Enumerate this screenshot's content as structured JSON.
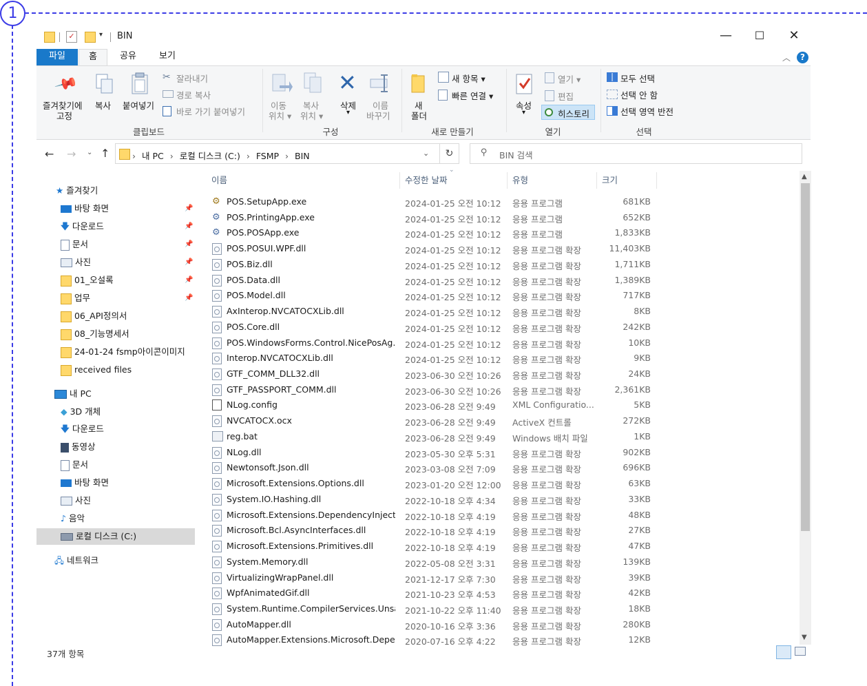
{
  "annotation": {
    "number": "1"
  },
  "window": {
    "title": "BIN",
    "controls": {
      "minimize": "—",
      "maximize": "☐",
      "close": "✕"
    }
  },
  "ribbon_tabs": [
    "파일",
    "홈",
    "공유",
    "보기"
  ],
  "ribbon": {
    "pin_quick": "즐겨찾기에",
    "pin_quick2": "고정",
    "copy": "복사",
    "paste": "붙여넣기",
    "cut": "잘라내기",
    "copy_path": "경로 복사",
    "paste_shortcut": "바로 가기 붙여넣기",
    "group_clipboard": "클립보드",
    "move_to": "이동",
    "move_to2": "위치",
    "copy_to": "복사",
    "copy_to2": "위치",
    "delete": "삭제",
    "rename": "이름",
    "rename2": "바꾸기",
    "group_organize": "구성",
    "new_folder": "새",
    "new_folder2": "폴더",
    "new_item": "새 항목",
    "easy_access": "빠른 연결",
    "group_new": "새로 만들기",
    "properties": "속성",
    "open": "열기",
    "edit": "편집",
    "history": "히스토리",
    "group_open": "열기",
    "select_all": "모두 선택",
    "select_none": "선택 안 함",
    "invert_selection": "선택 영역 반전",
    "group_select": "선택"
  },
  "address": {
    "crumbs": [
      "내 PC",
      "로컬 디스크 (C:)",
      "FSMP",
      "BIN"
    ],
    "search_placeholder": "BIN 검색"
  },
  "nav": {
    "quick_access": "즐겨찾기",
    "quick_items": [
      "바탕 화면",
      "다운로드",
      "문서",
      "사진",
      "01_오설록",
      "업무",
      "06_API정의서",
      "08_기능명세서",
      "24-01-24 fsmp아이콘이미지",
      "received files"
    ],
    "this_pc": "내 PC",
    "pc_items": [
      "3D 개체",
      "다운로드",
      "동영상",
      "문서",
      "바탕 화면",
      "사진",
      "음악",
      "로컬 디스크 (C:)"
    ],
    "network": "네트워크"
  },
  "columns": {
    "name": "이름",
    "date": "수정한 날짜",
    "type": "유형",
    "size": "크기"
  },
  "files": [
    {
      "name": "POS.SetupApp.exe",
      "date": "2024-01-25 오전 10:12",
      "type": "응용 프로그램",
      "size": "681KB",
      "icon": "setup-exe"
    },
    {
      "name": "POS.PrintingApp.exe",
      "date": "2024-01-25 오전 10:12",
      "type": "응용 프로그램",
      "size": "652KB",
      "icon": "exe"
    },
    {
      "name": "POS.POSApp.exe",
      "date": "2024-01-25 오전 10:12",
      "type": "응용 프로그램",
      "size": "1,833KB",
      "icon": "exe"
    },
    {
      "name": "POS.POSUI.WPF.dll",
      "date": "2024-01-25 오전 10:12",
      "type": "응용 프로그램 확장",
      "size": "11,403KB",
      "icon": "dll"
    },
    {
      "name": "POS.Biz.dll",
      "date": "2024-01-25 오전 10:12",
      "type": "응용 프로그램 확장",
      "size": "1,711KB",
      "icon": "dll"
    },
    {
      "name": "POS.Data.dll",
      "date": "2024-01-25 오전 10:12",
      "type": "응용 프로그램 확장",
      "size": "1,389KB",
      "icon": "dll"
    },
    {
      "name": "POS.Model.dll",
      "date": "2024-01-25 오전 10:12",
      "type": "응용 프로그램 확장",
      "size": "717KB",
      "icon": "dll"
    },
    {
      "name": "AxInterop.NVCATOCXLib.dll",
      "date": "2024-01-25 오전 10:12",
      "type": "응용 프로그램 확장",
      "size": "8KB",
      "icon": "dll"
    },
    {
      "name": "POS.Core.dll",
      "date": "2024-01-25 오전 10:12",
      "type": "응용 프로그램 확장",
      "size": "242KB",
      "icon": "dll"
    },
    {
      "name": "POS.WindowsForms.Control.NicePosAg...",
      "date": "2024-01-25 오전 10:12",
      "type": "응용 프로그램 확장",
      "size": "10KB",
      "icon": "dll"
    },
    {
      "name": "Interop.NVCATOCXLib.dll",
      "date": "2024-01-25 오전 10:12",
      "type": "응용 프로그램 확장",
      "size": "9KB",
      "icon": "dll"
    },
    {
      "name": "GTF_COMM_DLL32.dll",
      "date": "2023-06-30 오전 10:26",
      "type": "응용 프로그램 확장",
      "size": "24KB",
      "icon": "dll"
    },
    {
      "name": "GTF_PASSPORT_COMM.dll",
      "date": "2023-06-30 오전 10:26",
      "type": "응용 프로그램 확장",
      "size": "2,361KB",
      "icon": "dll"
    },
    {
      "name": "NLog.config",
      "date": "2023-06-28 오전 9:49",
      "type": "XML Configuratio...",
      "size": "5KB",
      "icon": "config"
    },
    {
      "name": "NVCATOCX.ocx",
      "date": "2023-06-28 오전 9:49",
      "type": "ActiveX 컨트롤",
      "size": "272KB",
      "icon": "dll"
    },
    {
      "name": "reg.bat",
      "date": "2023-06-28 오전 9:49",
      "type": "Windows 배치 파일",
      "size": "1KB",
      "icon": "bat"
    },
    {
      "name": "NLog.dll",
      "date": "2023-05-30 오후 5:31",
      "type": "응용 프로그램 확장",
      "size": "902KB",
      "icon": "dll"
    },
    {
      "name": "Newtonsoft.Json.dll",
      "date": "2023-03-08 오전 7:09",
      "type": "응용 프로그램 확장",
      "size": "696KB",
      "icon": "dll"
    },
    {
      "name": "Microsoft.Extensions.Options.dll",
      "date": "2023-01-20 오전 12:00",
      "type": "응용 프로그램 확장",
      "size": "63KB",
      "icon": "dll"
    },
    {
      "name": "System.IO.Hashing.dll",
      "date": "2022-10-18 오후 4:34",
      "type": "응용 프로그램 확장",
      "size": "33KB",
      "icon": "dll"
    },
    {
      "name": "Microsoft.Extensions.DependencyInjecti...",
      "date": "2022-10-18 오후 4:19",
      "type": "응용 프로그램 확장",
      "size": "48KB",
      "icon": "dll"
    },
    {
      "name": "Microsoft.Bcl.AsyncInterfaces.dll",
      "date": "2022-10-18 오후 4:19",
      "type": "응용 프로그램 확장",
      "size": "27KB",
      "icon": "dll"
    },
    {
      "name": "Microsoft.Extensions.Primitives.dll",
      "date": "2022-10-18 오후 4:19",
      "type": "응용 프로그램 확장",
      "size": "47KB",
      "icon": "dll"
    },
    {
      "name": "System.Memory.dll",
      "date": "2022-05-08 오전 3:31",
      "type": "응용 프로그램 확장",
      "size": "139KB",
      "icon": "dll"
    },
    {
      "name": "VirtualizingWrapPanel.dll",
      "date": "2021-12-17 오후 7:30",
      "type": "응용 프로그램 확장",
      "size": "39KB",
      "icon": "dll"
    },
    {
      "name": "WpfAnimatedGif.dll",
      "date": "2021-10-23 오후 4:53",
      "type": "응용 프로그램 확장",
      "size": "42KB",
      "icon": "dll"
    },
    {
      "name": "System.Runtime.CompilerServices.Unsaf...",
      "date": "2021-10-22 오후 11:40",
      "type": "응용 프로그램 확장",
      "size": "18KB",
      "icon": "dll"
    },
    {
      "name": "AutoMapper.dll",
      "date": "2020-10-16 오후 3:36",
      "type": "응용 프로그램 확장",
      "size": "280KB",
      "icon": "dll"
    },
    {
      "name": "AutoMapper.Extensions.Microsoft.Depe...",
      "date": "2020-07-16 오후 4:22",
      "type": "응용 프로그램 확장",
      "size": "12KB",
      "icon": "dll"
    }
  ],
  "status": {
    "item_count": "37개 항목"
  },
  "colors": {
    "accent": "#1979ca",
    "annotation": "#3b3be6",
    "folder": "#ffd86b"
  }
}
